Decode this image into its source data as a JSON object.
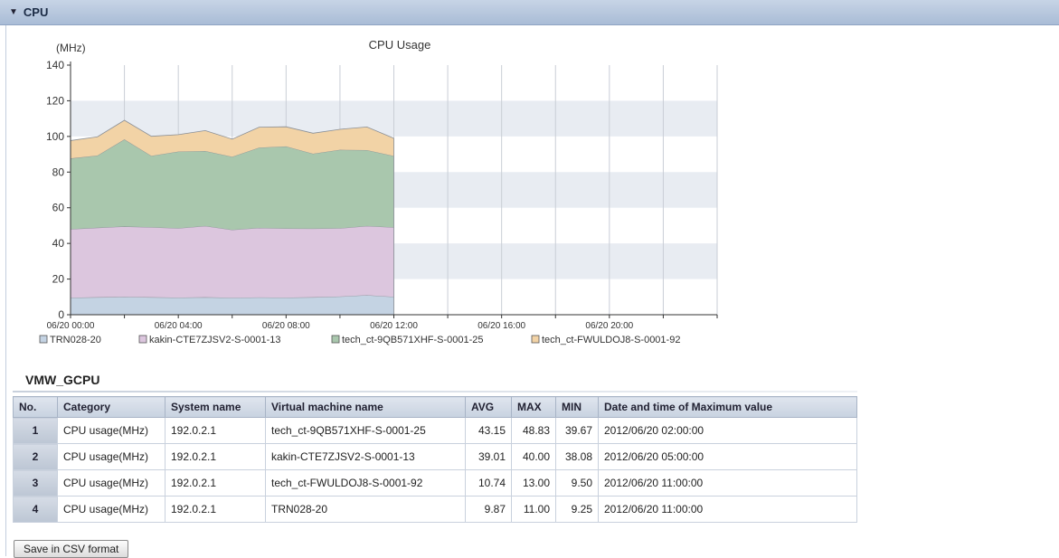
{
  "section": {
    "title": "CPU"
  },
  "chart_data": {
    "type": "area",
    "stacked": true,
    "title": "CPU Usage",
    "ylabel": "(MHz)",
    "ylim": [
      0,
      140
    ],
    "yticks": [
      0,
      20,
      40,
      60,
      80,
      100,
      120,
      140
    ],
    "xtick_labels": [
      "06/20 00:00",
      "06/20 04:00",
      "06/20 08:00",
      "06/20 12:00",
      "06/20 16:00",
      "06/20 20:00"
    ],
    "x": [
      "00:00",
      "01:00",
      "02:00",
      "03:00",
      "04:00",
      "05:00",
      "06:00",
      "07:00",
      "08:00",
      "09:00",
      "10:00",
      "11:00",
      "12:00"
    ],
    "x_range_hours": [
      0,
      24
    ],
    "grid": true,
    "legend_position": "bottom",
    "series": [
      {
        "name": "TRN028-20",
        "color": "#c4d3e3",
        "values": [
          9.5,
          9.8,
          10.0,
          9.8,
          9.6,
          9.8,
          9.5,
          9.7,
          9.6,
          9.8,
          10.2,
          11.0,
          10.0
        ]
      },
      {
        "name": "kakin-CTE7ZJSV2-S-0001-13",
        "color": "#dcc6de",
        "values": [
          38.5,
          39.0,
          39.5,
          39.3,
          38.9,
          40.0,
          38.1,
          39.0,
          38.8,
          38.5,
          38.3,
          38.8,
          39.0
        ]
      },
      {
        "name": "tech_ct-9QB571XHF-S-0001-25",
        "color": "#a9c7ad",
        "values": [
          39.67,
          40.5,
          48.83,
          40.0,
          43.0,
          42.0,
          41.0,
          45.0,
          46.0,
          42.0,
          44.0,
          42.5,
          40.0
        ]
      },
      {
        "name": "tech_ct-FWULDOJ8-S-0001-92",
        "color": "#f2d3a6",
        "values": [
          10.0,
          10.5,
          10.74,
          11.0,
          9.5,
          11.5,
          9.9,
          11.5,
          11.0,
          11.5,
          11.5,
          13.0,
          10.0
        ]
      }
    ]
  },
  "table": {
    "title": "VMW_GCPU",
    "headers": [
      "No.",
      "Category",
      "System name",
      "Virtual machine name",
      "AVG",
      "MAX",
      "MIN",
      "Date and time of Maximum value"
    ],
    "rows": [
      [
        "1",
        "CPU usage(MHz)",
        "192.0.2.1",
        "tech_ct-9QB571XHF-S-0001-25",
        "43.15",
        "48.83",
        "39.67",
        "2012/06/20 02:00:00"
      ],
      [
        "2",
        "CPU usage(MHz)",
        "192.0.2.1",
        "kakin-CTE7ZJSV2-S-0001-13",
        "39.01",
        "40.00",
        "38.08",
        "2012/06/20 05:00:00"
      ],
      [
        "3",
        "CPU usage(MHz)",
        "192.0.2.1",
        "tech_ct-FWULDOJ8-S-0001-92",
        "10.74",
        "13.00",
        "9.50",
        "2012/06/20 11:00:00"
      ],
      [
        "4",
        "CPU usage(MHz)",
        "192.0.2.1",
        "TRN028-20",
        "9.87",
        "11.00",
        "9.25",
        "2012/06/20 11:00:00"
      ]
    ]
  },
  "buttons": {
    "save_csv": "Save in CSV format"
  }
}
